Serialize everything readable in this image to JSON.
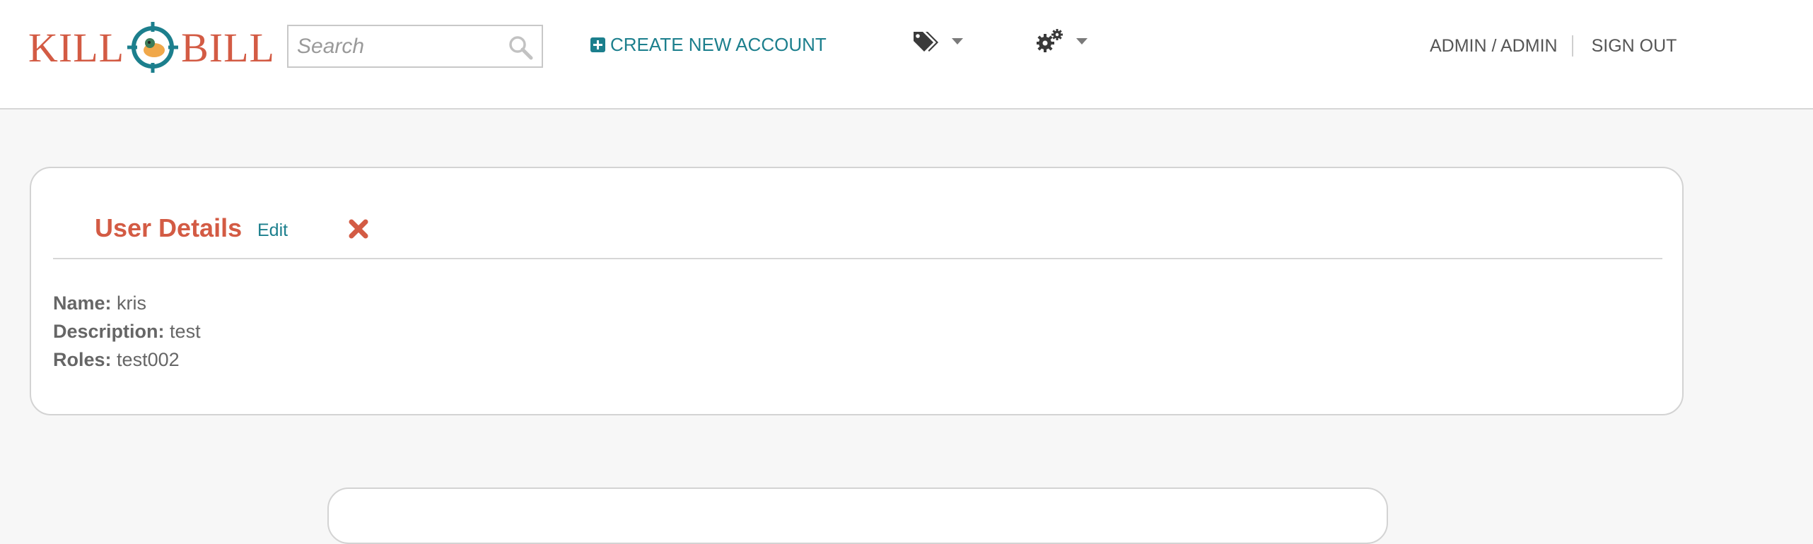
{
  "header": {
    "logo_left": "KILL",
    "logo_right": "BILL",
    "search_placeholder": "Search",
    "create_account_label": "CREATE NEW ACCOUNT",
    "tags_menu_icon": "tags-icon",
    "settings_menu_icon": "gears-icon",
    "user_label": "ADMIN / ADMIN",
    "sign_out_label": "SIGN OUT"
  },
  "panel": {
    "title": "User Details",
    "edit_label": "Edit",
    "delete_icon": "close-icon",
    "fields": [
      {
        "label": "Name:",
        "value": "kris"
      },
      {
        "label": "Description:",
        "value": "test"
      },
      {
        "label": "Roles:",
        "value": "test002"
      }
    ]
  },
  "colors": {
    "brand": "#d35b44",
    "link": "#1c7f8d",
    "background": "#f7f7f7"
  }
}
